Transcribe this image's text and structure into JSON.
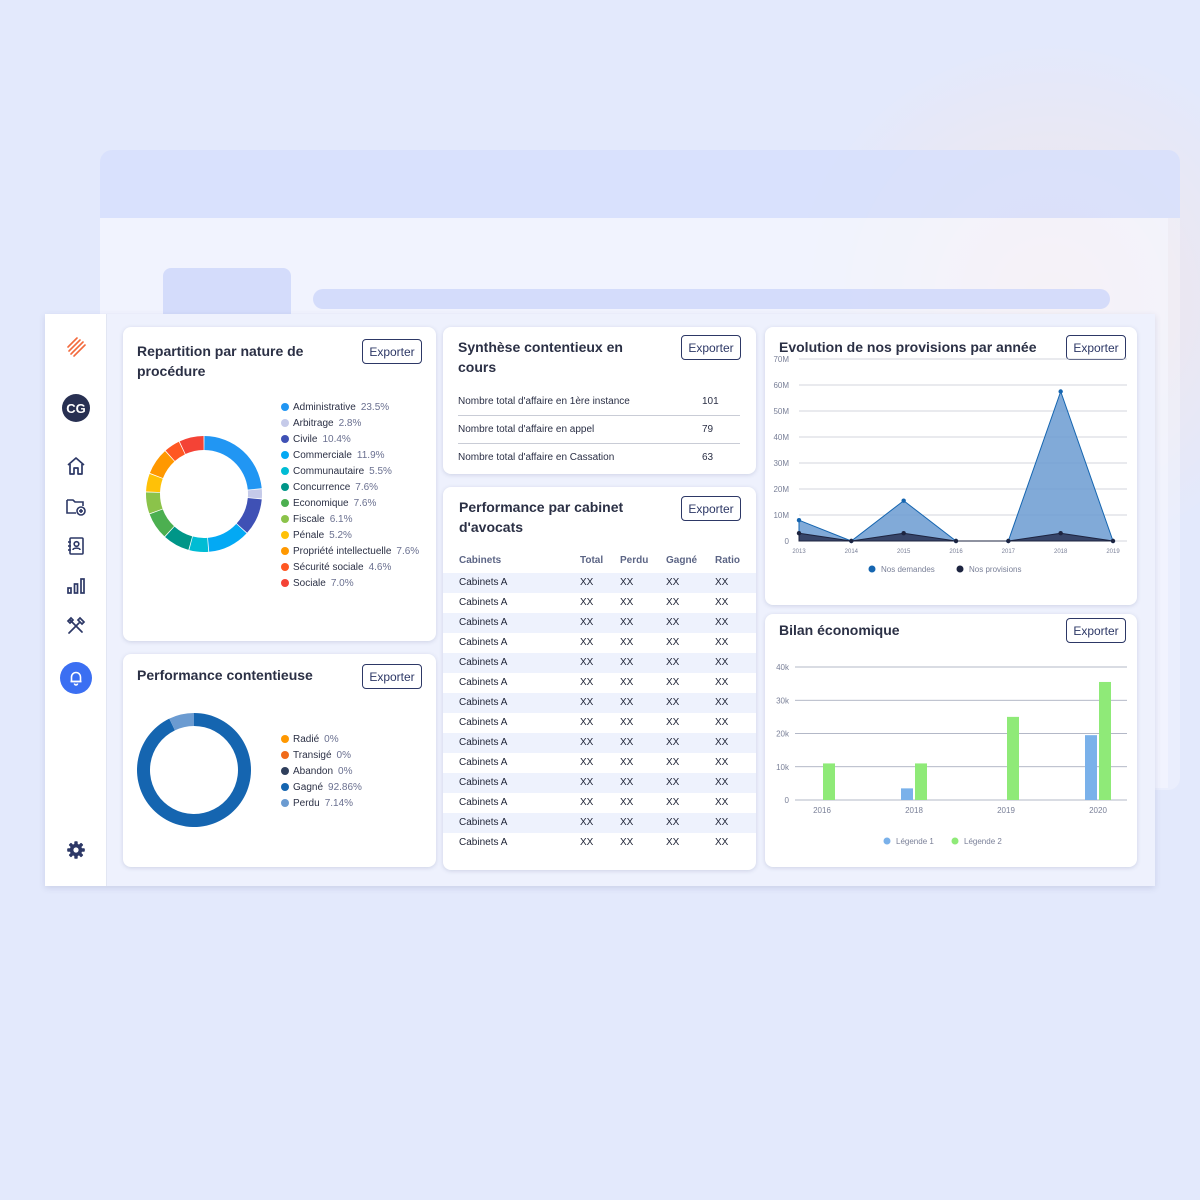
{
  "sidebar": {
    "avatar_initials": "CG",
    "icons": [
      "logo-icon",
      "home-icon",
      "folder-add-icon",
      "contacts-icon",
      "bar-chart-icon",
      "tools-icon",
      "bell-icon",
      "settings-icon"
    ]
  },
  "colors": {
    "accent": "#3b6ff2",
    "navy": "#283052",
    "area_demandes": "#6b9bd1",
    "area_provisions": "#2f3a5d",
    "bar_legend1": "#7ab1ea",
    "bar_legend2": "#8fea78"
  },
  "common": {
    "export_label": "Exporter"
  },
  "repartition": {
    "title_line1": "Repartition par nature de",
    "title_line2": "procédure",
    "items": [
      {
        "label": "Administrative",
        "pct": "23.5%",
        "value": 23.5,
        "color": "#2196f3"
      },
      {
        "label": "Arbitrage",
        "pct": "2.8%",
        "value": 2.8,
        "color": "#c5cae9"
      },
      {
        "label": "Civile",
        "pct": "10.4%",
        "value": 10.4,
        "color": "#3f51b5"
      },
      {
        "label": "Commerciale",
        "pct": "11.9%",
        "value": 11.9,
        "color": "#03a9f4"
      },
      {
        "label": "Communautaire",
        "pct": "5.5%",
        "value": 5.5,
        "color": "#00bcd4"
      },
      {
        "label": "Concurrence",
        "pct": "7.6%",
        "value": 7.6,
        "color": "#009688"
      },
      {
        "label": "Economique",
        "pct": "7.6%",
        "value": 7.6,
        "color": "#4caf50"
      },
      {
        "label": "Fiscale",
        "pct": "6.1%",
        "value": 6.1,
        "color": "#8bc34a"
      },
      {
        "label": "Pénale",
        "pct": "5.2%",
        "value": 5.2,
        "color": "#ffc107"
      },
      {
        "label": "Propriété intellectuelle",
        "pct": "7.6%",
        "value": 7.6,
        "color": "#ff9800"
      },
      {
        "label": "Sécurité sociale",
        "pct": "4.6%",
        "value": 4.6,
        "color": "#ff5722"
      },
      {
        "label": "Sociale",
        "pct": "7.0%",
        "value": 7.0,
        "color": "#f44336"
      }
    ]
  },
  "performance_contentieuse": {
    "title": "Performance contentieuse",
    "items": [
      {
        "label": "Radié",
        "pct": "0%",
        "value": 0,
        "color": "#ff9800"
      },
      {
        "label": "Transigé",
        "pct": "0%",
        "value": 0,
        "color": "#f06a1a"
      },
      {
        "label": "Abandon",
        "pct": "0%",
        "value": 0,
        "color": "#2f3f5c"
      },
      {
        "label": "Gagné",
        "pct": "92.86%",
        "value": 92.86,
        "color": "#1565b0"
      },
      {
        "label": "Perdu",
        "pct": "7.14%",
        "value": 7.14,
        "color": "#6b9bd1"
      }
    ]
  },
  "synthese": {
    "title_line1": "Synthèse contentieux en",
    "title_line2": "cours",
    "rows": [
      {
        "label": "Nombre total d'affaire en 1ère instance",
        "value": "101"
      },
      {
        "label": "Nombre total d'affaire en appel",
        "value": "79"
      },
      {
        "label": "Nombre total d'affaire en Cassation",
        "value": "63"
      }
    ]
  },
  "performance_cabinet": {
    "title_line1": "Performance par cabinet",
    "title_line2": "d'avocats",
    "columns": [
      "Cabinets",
      "Total",
      "Perdu",
      "Gagné",
      "Ratio"
    ],
    "rows": [
      [
        "Cabinets A",
        "XX",
        "XX",
        "XX",
        "XX"
      ],
      [
        "Cabinets A",
        "XX",
        "XX",
        "XX",
        "XX"
      ],
      [
        "Cabinets A",
        "XX",
        "XX",
        "XX",
        "XX"
      ],
      [
        "Cabinets A",
        "XX",
        "XX",
        "XX",
        "XX"
      ],
      [
        "Cabinets A",
        "XX",
        "XX",
        "XX",
        "XX"
      ],
      [
        "Cabinets A",
        "XX",
        "XX",
        "XX",
        "XX"
      ],
      [
        "Cabinets A",
        "XX",
        "XX",
        "XX",
        "XX"
      ],
      [
        "Cabinets A",
        "XX",
        "XX",
        "XX",
        "XX"
      ],
      [
        "Cabinets A",
        "XX",
        "XX",
        "XX",
        "XX"
      ],
      [
        "Cabinets A",
        "XX",
        "XX",
        "XX",
        "XX"
      ],
      [
        "Cabinets A",
        "XX",
        "XX",
        "XX",
        "XX"
      ],
      [
        "Cabinets A",
        "XX",
        "XX",
        "XX",
        "XX"
      ],
      [
        "Cabinets A",
        "XX",
        "XX",
        "XX",
        "XX"
      ],
      [
        "Cabinets A",
        "XX",
        "XX",
        "XX",
        "XX"
      ]
    ]
  },
  "evolution": {
    "title": "Evolution de nos provisions par année"
  },
  "bilan": {
    "title": "Bilan économique"
  },
  "chart_data": [
    {
      "type": "area",
      "title": "Evolution de nos provisions par année",
      "categories": [
        "2013",
        "2014",
        "2015",
        "2016",
        "2017",
        "2018",
        "2019"
      ],
      "y_ticks": [
        "0",
        "10M",
        "20M",
        "30M",
        "40M",
        "50M",
        "60M",
        "70M"
      ],
      "ylim": [
        0,
        70
      ],
      "grid": true,
      "legend_position": "bottom",
      "series": [
        {
          "name": "Nos demandes",
          "values": [
            8,
            0,
            15.5,
            0,
            0,
            57.5,
            0
          ],
          "color": "#6b9bd1",
          "stroke": "#1565b0"
        },
        {
          "name": "Nos provisions",
          "values": [
            3,
            0,
            3,
            0,
            0,
            3,
            0
          ],
          "color": "#2f3a5d",
          "stroke": "#1d2440"
        }
      ]
    },
    {
      "type": "bar",
      "title": "Bilan économique",
      "categories": [
        "2016",
        "2018",
        "2019",
        "2020"
      ],
      "y_ticks": [
        "0",
        "10k",
        "20k",
        "30k",
        "40k"
      ],
      "ylim": [
        0,
        40
      ],
      "grid": true,
      "legend_position": "bottom",
      "series": [
        {
          "name": "Légende 1",
          "values": [
            0,
            3.5,
            0,
            19.5
          ],
          "color": "#7ab1ea"
        },
        {
          "name": "Légende 2",
          "values": [
            11,
            11,
            25,
            35.5
          ],
          "color": "#8fea78"
        }
      ]
    }
  ]
}
